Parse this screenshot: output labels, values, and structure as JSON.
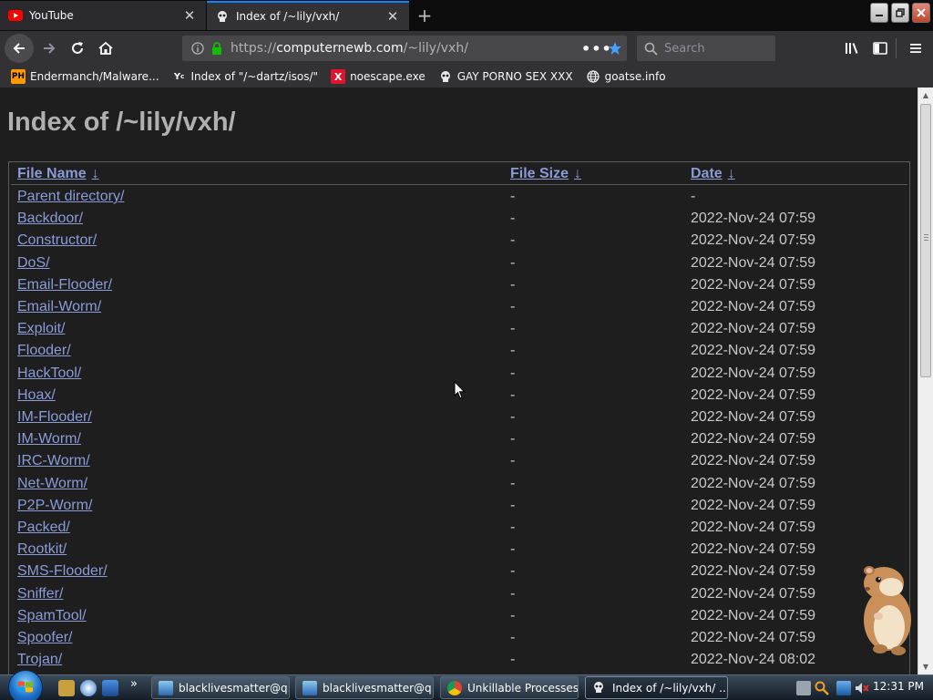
{
  "tabs": [
    {
      "title": "YouTube",
      "active": false
    },
    {
      "title": "Index of /~lily/vxh/",
      "active": true
    }
  ],
  "navbar": {
    "url_scheme": "https://",
    "url_host": "computernewb.com",
    "url_path": "/~lily/vxh/",
    "search_placeholder": "Search"
  },
  "bookmarks": [
    {
      "label": "Endermanch/Malware...",
      "icon": "ph-icon"
    },
    {
      "label": "Index of \"/~dartz/isos/\"",
      "icon": "yc-icon"
    },
    {
      "label": "noescape.exe",
      "icon": "x-icon"
    },
    {
      "label": "GAY PORNO SEX XXX",
      "icon": "skull-icon"
    },
    {
      "label": "goatse.info",
      "icon": "globe-icon"
    }
  ],
  "page": {
    "title": "Index of /~lily/vxh/",
    "headers": {
      "name": "File Name",
      "size": "File Size",
      "date": "Date",
      "arrow": "↓"
    },
    "rows": [
      {
        "name": "Parent directory/",
        "size": "-",
        "date": "-"
      },
      {
        "name": "Backdoor/",
        "size": "-",
        "date": "2022-Nov-24 07:59"
      },
      {
        "name": "Constructor/",
        "size": "-",
        "date": "2022-Nov-24 07:59"
      },
      {
        "name": "DoS/",
        "size": "-",
        "date": "2022-Nov-24 07:59"
      },
      {
        "name": "Email-Flooder/",
        "size": "-",
        "date": "2022-Nov-24 07:59"
      },
      {
        "name": "Email-Worm/",
        "size": "-",
        "date": "2022-Nov-24 07:59"
      },
      {
        "name": "Exploit/",
        "size": "-",
        "date": "2022-Nov-24 07:59"
      },
      {
        "name": "Flooder/",
        "size": "-",
        "date": "2022-Nov-24 07:59"
      },
      {
        "name": "HackTool/",
        "size": "-",
        "date": "2022-Nov-24 07:59"
      },
      {
        "name": "Hoax/",
        "size": "-",
        "date": "2022-Nov-24 07:59"
      },
      {
        "name": "IM-Flooder/",
        "size": "-",
        "date": "2022-Nov-24 07:59"
      },
      {
        "name": "IM-Worm/",
        "size": "-",
        "date": "2022-Nov-24 07:59"
      },
      {
        "name": "IRC-Worm/",
        "size": "-",
        "date": "2022-Nov-24 07:59"
      },
      {
        "name": "Net-Worm/",
        "size": "-",
        "date": "2022-Nov-24 07:59"
      },
      {
        "name": "P2P-Worm/",
        "size": "-",
        "date": "2022-Nov-24 07:59"
      },
      {
        "name": "Packed/",
        "size": "-",
        "date": "2022-Nov-24 07:59"
      },
      {
        "name": "Rootkit/",
        "size": "-",
        "date": "2022-Nov-24 07:59"
      },
      {
        "name": "SMS-Flooder/",
        "size": "-",
        "date": "2022-Nov-24 07:59"
      },
      {
        "name": "Sniffer/",
        "size": "-",
        "date": "2022-Nov-24 07:59"
      },
      {
        "name": "SpamTool/",
        "size": "-",
        "date": "2022-Nov-24 07:59"
      },
      {
        "name": "Spoofer/",
        "size": "-",
        "date": "2022-Nov-24 07:59"
      },
      {
        "name": "Trojan/",
        "size": "-",
        "date": "2022-Nov-24 08:02"
      }
    ]
  },
  "taskbar": {
    "buttons": [
      {
        "label": "blacklivesmatter@q...",
        "icon": "explorer-icon",
        "active": false
      },
      {
        "label": "blacklivesmatter@q...",
        "icon": "explorer-icon",
        "active": false
      },
      {
        "label": "Unkillable Processes...",
        "icon": "chrome-icon",
        "active": false
      },
      {
        "label": "Index of /~lily/vxh/ ...",
        "icon": "firefox-icon",
        "active": true
      }
    ],
    "overflow": "»",
    "clock": "12:31 PM"
  },
  "colors": {
    "accent": "#0a84ff",
    "link": "#8a9bd8",
    "page_bg": "#1e1e1e",
    "heading": "#b0b0b0",
    "secure_lock": "#12bc00",
    "bookmark_star": "#45a1ff"
  }
}
